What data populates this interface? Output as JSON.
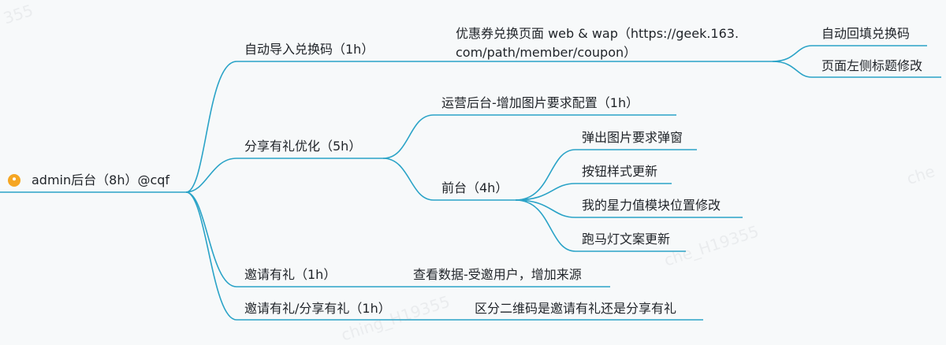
{
  "mindmap": {
    "root": {
      "label": "admin后台（8h）@cqf",
      "icon": "user-icon"
    },
    "line_color": "#2aa3c7",
    "branches": [
      {
        "label": "自动导入兑换码（1h）",
        "child": {
          "line1": "优惠券兑换页面 web & wap（https://geek.163.",
          "line2": "com/path/member/coupon）",
          "children": [
            "自动回填兑换码",
            "页面左侧标题修改"
          ]
        }
      },
      {
        "label": "分享有礼优化（5h）",
        "children": [
          {
            "label": "运营后台-增加图片要求配置（1h）"
          },
          {
            "label": "前台（4h）",
            "children": [
              "弹出图片要求弹窗",
              "按钮样式更新",
              "我的星力值模块位置修改",
              "跑马灯文案更新"
            ]
          }
        ]
      },
      {
        "label": "邀请有礼（1h）",
        "child": "查看数据-受邀用户，增加来源"
      },
      {
        "label": "邀请有礼/分享有礼（1h）",
        "child": "区分二维码是邀请有礼还是分享有礼"
      }
    ]
  },
  "watermark": [
    "355",
    "che",
    "che_H19355",
    "ching_H19355"
  ]
}
